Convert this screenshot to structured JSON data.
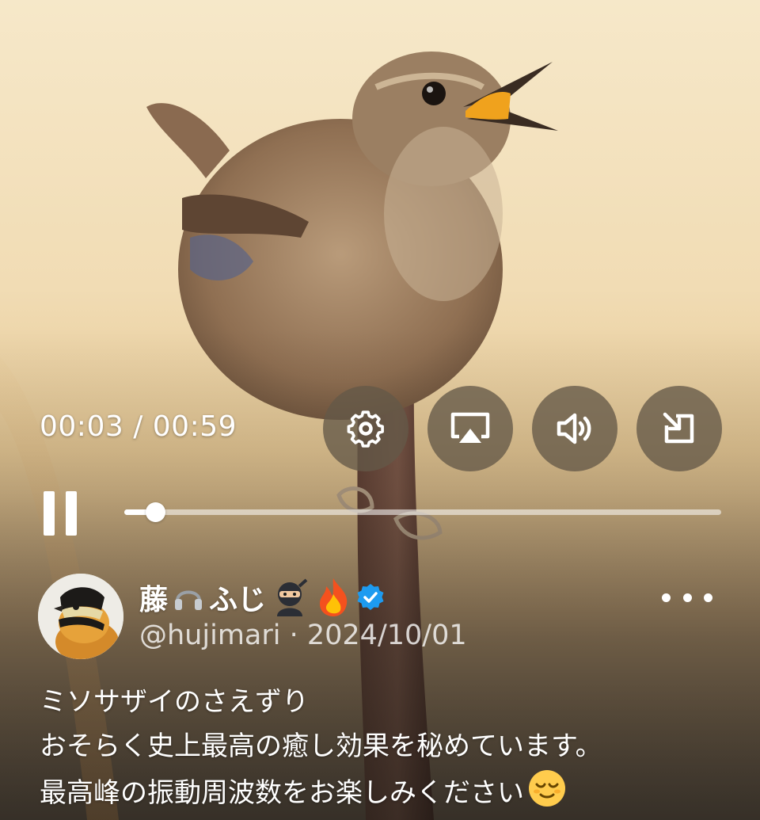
{
  "player": {
    "time": "00:03 / 00:59",
    "progress": 0.052,
    "controls": {
      "settings_icon": "gear-icon",
      "airplay_icon": "airplay-icon",
      "volume_icon": "speaker-icon",
      "exit_icon": "exit-fullscreen-icon"
    },
    "playback_state": "playing",
    "pause_icon": "pause-icon"
  },
  "post": {
    "display_name_prefix": "藤",
    "display_name_mid": "ふじ",
    "name_emojis": [
      "headphones",
      "ninja",
      "fire"
    ],
    "verified_icon": "verified-badge-icon",
    "handle": "@hujimari",
    "separator": " · ",
    "date": "2024/10/01",
    "more_icon": "more-icon",
    "text_lines": [
      "ミソサザイのさえずり",
      "おそらく史上最高の癒し効果を秘めています。",
      "最高峰の振動周波数をお楽しみください"
    ],
    "trailing_emoji": "relieved-face"
  },
  "colors": {
    "control_bg": "#645848",
    "verified_blue": "#1d9bf0",
    "text": "#ffffff"
  }
}
